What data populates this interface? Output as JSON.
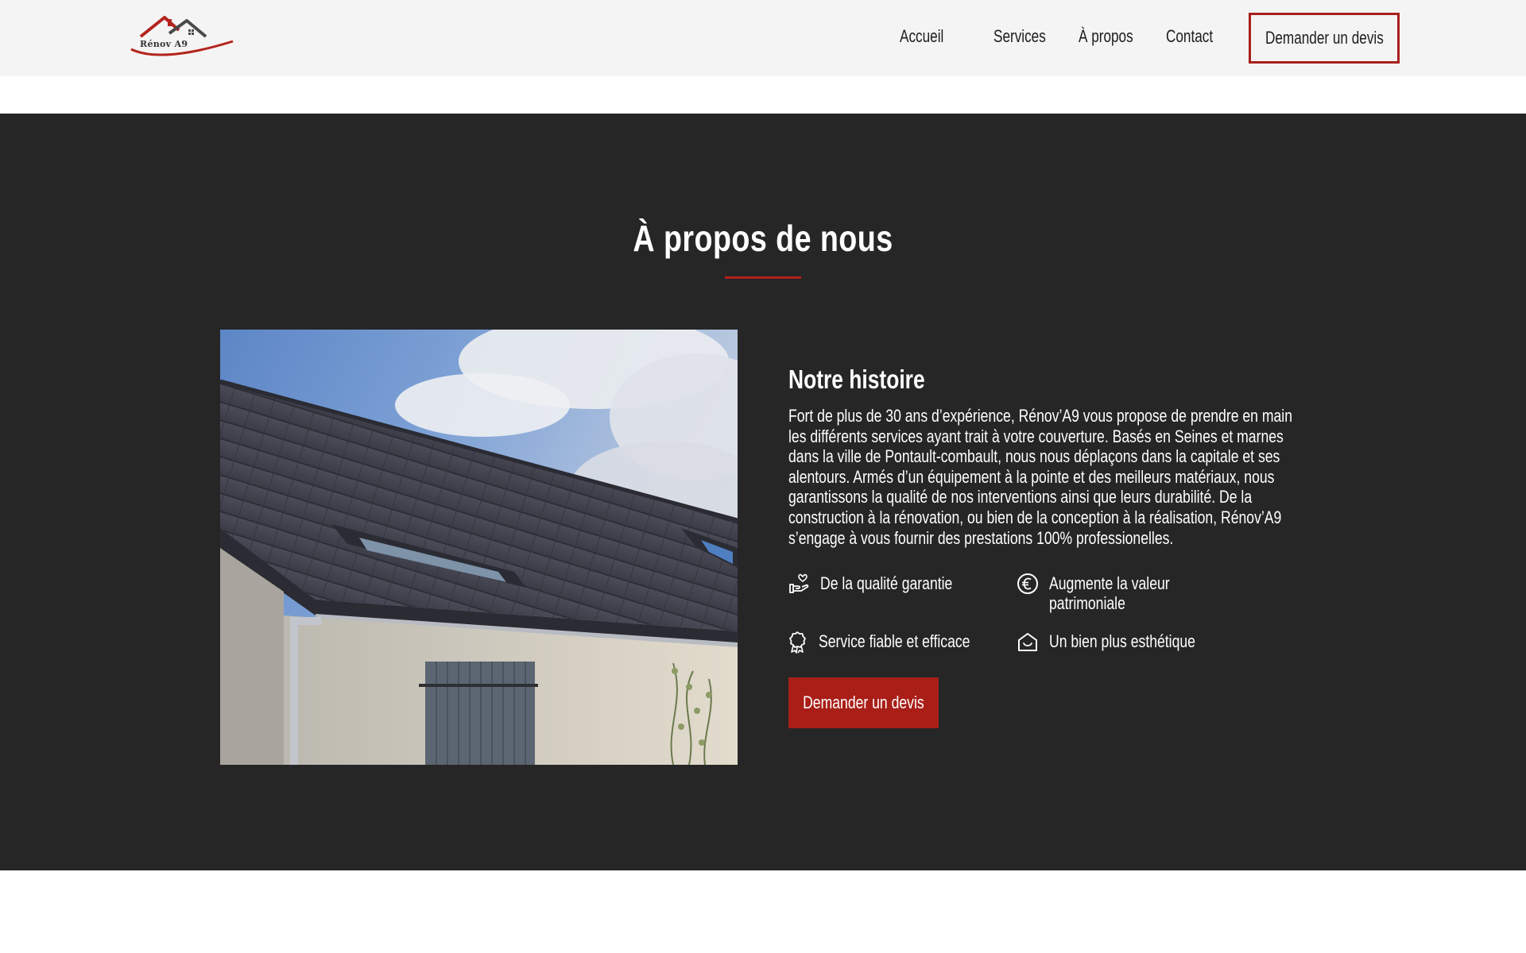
{
  "colors": {
    "accent": "#a91f18",
    "section_bg": "#262627",
    "header_bg": "#f4f4f4"
  },
  "header": {
    "logo_text": "Rénov A9",
    "nav": {
      "accueil": "Accueil",
      "services": "Services",
      "apropos": "À propos",
      "contact": "Contact"
    },
    "cta_label": "Demander un devis"
  },
  "about": {
    "title": "À propos de nous",
    "story_title": "Notre histoire",
    "story_text": "Fort de plus de 30 ans d’expérience, Rénov’A9 vous propose de prendre en main les différents services ayant trait à votre couverture. Basés en Seines et marnes dans la ville de Pontault-combault, nous nous déplaçons dans la capitale et ses alentours. Armés d’un équipement à la pointe et des meilleurs matériaux, nous garantissons la qualité de nos interventions ainsi que leurs durabilité. De la construction à la rénovation, ou bien de la conception à la réalisation, Rénov’A9 s’engage à vous fournir des prestations 100% professionelles.",
    "features": [
      {
        "icon": "hand-heart-icon",
        "label": "De la qualité garantie"
      },
      {
        "icon": "euro-circle-icon",
        "label": "Augmente la valeur patrimoniale"
      },
      {
        "icon": "award-ribbon-icon",
        "label": "Service fiable et efficace"
      },
      {
        "icon": "house-smile-icon",
        "label": "Un bien plus esthétique"
      }
    ],
    "cta_label": "Demander un devis"
  }
}
